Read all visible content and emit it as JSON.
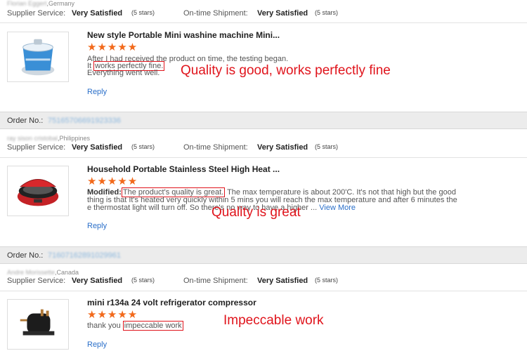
{
  "top": {
    "buyer_name": "Florian Eggert",
    "buyer_country": ",Germany",
    "supplier_label": "Supplier Service:",
    "supplier_value": "Very Satisfied",
    "supplier_stars": "(5 stars)",
    "shipment_label": "On-time Shipment:",
    "shipment_value": "Very Satisfied",
    "shipment_stars": "(5 stars)"
  },
  "reviews": [
    {
      "title": "New style Portable Mini washine machine Mini...",
      "stars": "★★★★★",
      "line1": "After I had received the product on time, the testing began.",
      "line2_prefix": "It ",
      "line2_highlight": "works perfectly fine.",
      "line3": "Everything went well.",
      "reply": "Reply",
      "annotation": "Quality is good, works perfectly fine"
    },
    {
      "order_label": "Order No.:",
      "order_number": "75165706691923336",
      "buyer_name": "ray sison cristobal",
      "buyer_country": ",Philippines",
      "supplier_label": "Supplier Service:",
      "supplier_value": "Very Satisfied",
      "supplier_stars": "(5 stars)",
      "shipment_label": "On-time Shipment:",
      "shipment_value": "Very Satisfied",
      "shipment_stars": "(5 stars)",
      "title": "Household Portable Stainless Steel High Heat ...",
      "stars": "★★★★★",
      "modified_label": "Modified:",
      "highlight": "The product's quality is great.",
      "line1_rest": " The max temperature is about 200'C.  It's not that high but the good",
      "line2": "thing is that It's heated very quickly within 5 mins you will reach the max temperature and after 6 minutes the",
      "line3": "e thermostat light will turn off. So there's no way to have a higher ... ",
      "view_more": "View More",
      "reply": "Reply",
      "annotation": "Quality is great"
    },
    {
      "order_label": "Order No.:",
      "order_number": "71607162891029961",
      "buyer_name": "Andre Morissette",
      "buyer_country": ",Canada",
      "supplier_label": "Supplier Service:",
      "supplier_value": "Very Satisfied",
      "supplier_stars": "(5 stars)",
      "shipment_label": "On-time Shipment:",
      "shipment_value": "Very Satisfied",
      "shipment_stars": "(5 stars)",
      "title": "mini r134a 24 volt refrigerator compressor",
      "stars": "★★★★★",
      "text_prefix": "thank you ",
      "highlight": "impeccable work",
      "reply": "Reply",
      "annotation": "Impeccable work"
    }
  ],
  "colors": {
    "stars": "#f2691b",
    "annotation": "#e0141c",
    "link": "#2a6fc9"
  }
}
